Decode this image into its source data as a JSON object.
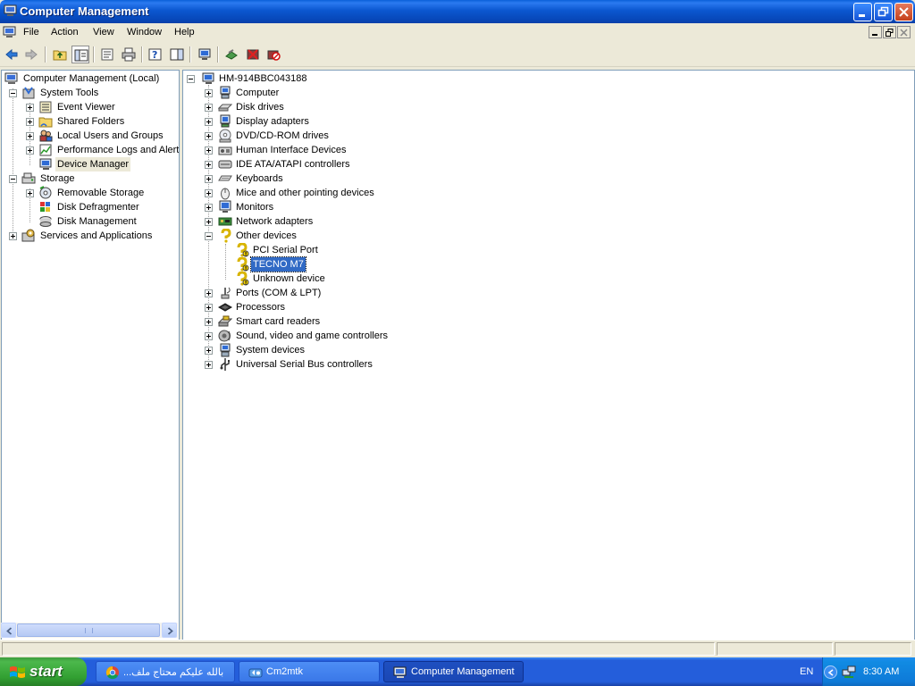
{
  "window": {
    "title": "Computer Management"
  },
  "menu": {
    "items": [
      "File",
      "Action",
      "View",
      "Window",
      "Help"
    ]
  },
  "left_tree": {
    "root": "Computer Management (Local)",
    "system_tools": "System Tools",
    "event_viewer": "Event Viewer",
    "shared_folders": "Shared Folders",
    "local_users": "Local Users and Groups",
    "perf_logs": "Performance Logs and Alerts",
    "device_manager": "Device Manager",
    "storage": "Storage",
    "removable_storage": "Removable Storage",
    "disk_defrag": "Disk Defragmenter",
    "disk_mgmt": "Disk Management",
    "services_apps": "Services and Applications"
  },
  "device_tree": {
    "root": "HM-914BBC043188",
    "categories": [
      "Computer",
      "Disk drives",
      "Display adapters",
      "DVD/CD-ROM drives",
      "Human Interface Devices",
      "IDE ATA/ATAPI controllers",
      "Keyboards",
      "Mice and other pointing devices",
      "Monitors",
      "Network adapters",
      "Other devices"
    ],
    "other_devices": [
      "PCI Serial Port",
      "TECNO M7",
      "Unknown device"
    ],
    "categories_after": [
      "Ports (COM & LPT)",
      "Processors",
      "Smart card readers",
      "Sound, video and game controllers",
      "System devices",
      "Universal Serial Bus controllers"
    ],
    "selected": "TECNO M7"
  },
  "taskbar": {
    "start_label": "start",
    "tasks": [
      {
        "label": "...بالله عليكم محتاج ملف",
        "icon": "chrome-icon"
      },
      {
        "label": "Cm2mtk",
        "icon": "app-icon"
      },
      {
        "label": "Computer Management",
        "icon": "computer-management-icon",
        "active": true
      }
    ],
    "language": "EN",
    "clock": "8:30 AM"
  },
  "colors": {
    "titlebar_blue": "#0b57d0",
    "selection": "#316ac5",
    "taskbar_blue": "#245edb",
    "start_green": "#32a032"
  }
}
